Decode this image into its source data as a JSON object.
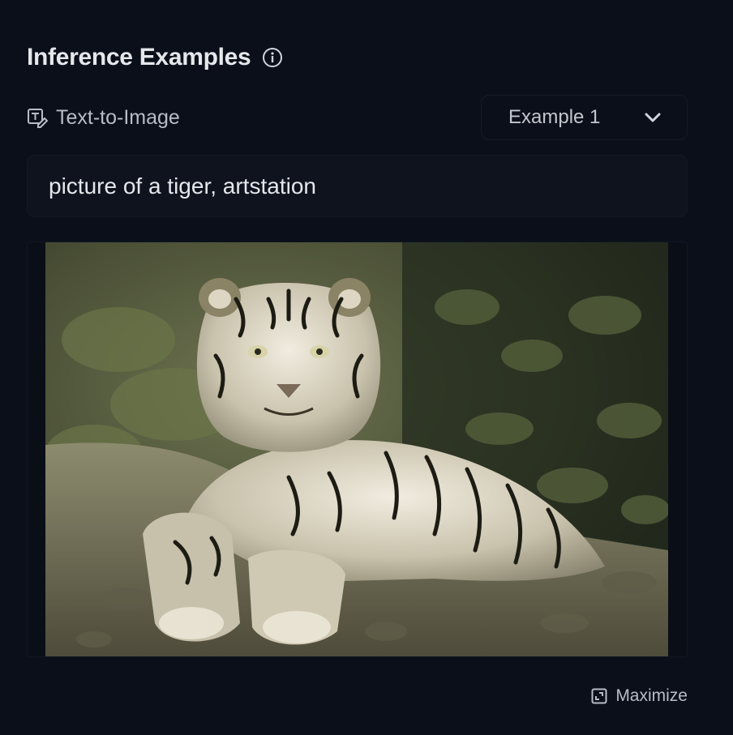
{
  "header": {
    "title": "Inference Examples",
    "info_icon": "info-circle-icon"
  },
  "toolbar": {
    "task_icon": "text-to-image-icon",
    "task_label": "Text-to-Image",
    "example_select": {
      "selected": "Example 1",
      "icon": "chevron-down-icon"
    }
  },
  "prompt": {
    "text": "picture of a tiger, artstation"
  },
  "output": {
    "image_description_icon": "generated-image"
  },
  "footer": {
    "maximize_label": "Maximize",
    "maximize_icon": "maximize-icon"
  },
  "colors": {
    "background": "#0b0f19",
    "text_primary": "#e5e7eb",
    "text_secondary": "#b8bcc4"
  }
}
